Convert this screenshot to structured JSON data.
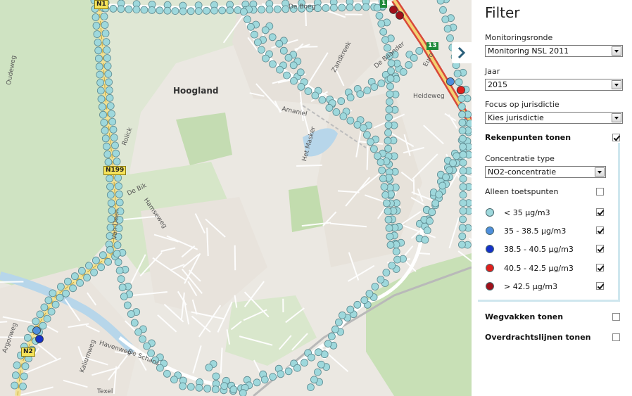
{
  "map": {
    "labels": {
      "hoogland": "Hoogland",
      "de_boeg": "De Boeg",
      "oudeweg": "Oudeweg",
      "zandkreek": "Zandkreek",
      "de_baander": "De Baander",
      "euro": "Euro",
      "heideweg": "Heideweg",
      "amaniel": "Amaniel",
      "het_masker": "Het Masker",
      "de_bik": "De Bik",
      "hamseweg": "Hamseweg",
      "rolick": "Rolick",
      "havenweg": "Havenweg",
      "de_schans": "De Schans",
      "kaliumweg": "Kaliumweg",
      "texel": "Texel",
      "argonweg": "Argonweg",
      "van_deen": "Van Deen"
    },
    "shields": {
      "n1_top": "N1",
      "n199": "N199",
      "n2_bottom": "N2",
      "exit_13": "13",
      "exit_top": "1"
    },
    "point_colors": {
      "lt35": "#9ed8dc",
      "c35_38": "#4f8fdc",
      "c38_40": "#1531c8",
      "c40_42": "#e0201c",
      "gt42": "#a0101a"
    }
  },
  "filter": {
    "title": "Filter",
    "monitoringsronde_label": "Monitoringsronde",
    "monitoringsronde_value": "Monitoring NSL 2011",
    "jaar_label": "Jaar",
    "jaar_value": "2015",
    "jurisdictie_label": "Focus op jurisdictie",
    "jurisdictie_value": "Kies jurisdictie",
    "rekenpunten_label": "Rekenpunten tonen",
    "rekenpunten_checked": true,
    "concentratie_label": "Concentratie type",
    "concentratie_value": "NO2-concentratie",
    "toetspunten_label": "Alleen toetspunten",
    "toetspunten_checked": false,
    "legend": [
      {
        "label": "< 35 µg/m3",
        "color": "#9ed8dc",
        "checked": true
      },
      {
        "label": "35 - 38.5 µg/m3",
        "color": "#4f8fdc",
        "checked": true
      },
      {
        "label": "38.5 - 40.5 µg/m3",
        "color": "#1531c8",
        "checked": true
      },
      {
        "label": "40.5 - 42.5 µg/m3",
        "color": "#e0201c",
        "checked": true
      },
      {
        "label": "> 42.5 µg/m3",
        "color": "#a0101a",
        "checked": true
      }
    ],
    "wegvakken_label": "Wegvakken tonen",
    "wegvakken_checked": false,
    "overdracht_label": "Overdrachtslijnen tonen",
    "overdracht_checked": false
  }
}
